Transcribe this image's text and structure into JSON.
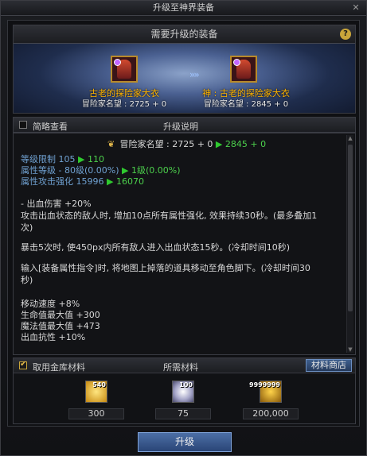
{
  "window": {
    "title": "升级至神界装备",
    "close_symbol": "✕"
  },
  "equip_panel": {
    "header": "需要升级的装备",
    "help_symbol": "?",
    "arrow_symbol": "»»",
    "source": {
      "name": "古老的探险家大衣",
      "fame": "冒险家名望 : 2725 + 0"
    },
    "target": {
      "name": "神 : 古老的探险家大衣",
      "fame": "冒险家名望 : 2845 + 0"
    }
  },
  "description": {
    "brief_view_label": "简略查看",
    "brief_view_checked": false,
    "header": "升级说明",
    "fame_line": {
      "label": "冒险家名望 : 2725 + 0",
      "arrow": "▶",
      "to": "2845 + 0"
    },
    "stat_changes": [
      {
        "label": "等级限制 105",
        "arrow": "▶",
        "to": "110"
      },
      {
        "label": "属性等级 - 80级(0.00%)",
        "arrow": "▶",
        "to": "1级(0.00%)"
      },
      {
        "label": "属性攻击强化 15996",
        "arrow": "▶",
        "to": "16070"
      }
    ],
    "effect_lines": [
      "- 出血伤害 +20%",
      "攻击出血状态的敌人时, 增加10点所有属性强化, 效果持续30秒。(最多叠加1",
      "次)",
      "暴击5次时, 使450px内所有敌人进入出血状态15秒。(冷却时间10秒)",
      "输入[装备属性指令]时, 将地图上掉落的道具移动至角色脚下。(冷却时间30",
      "秒)",
      "移动速度 +8%",
      "生命值最大值 +300",
      "魔法值最大值 +473",
      "出血抗性 +10%"
    ],
    "scroll_up": "▲",
    "scroll_down": "▼"
  },
  "materials": {
    "use_vault_label": "取用金库材料",
    "use_vault_checked": true,
    "header": "所需材料",
    "shop_button": "材料商店",
    "items": [
      {
        "icon": "crystal-icon",
        "stack": "540",
        "quantity": "300"
      },
      {
        "icon": "orb-icon",
        "stack": "100",
        "quantity": "75"
      },
      {
        "icon": "gold-coins-icon",
        "stack": "9999999",
        "quantity": "200,000"
      }
    ]
  },
  "upgrade_button": "升级"
}
